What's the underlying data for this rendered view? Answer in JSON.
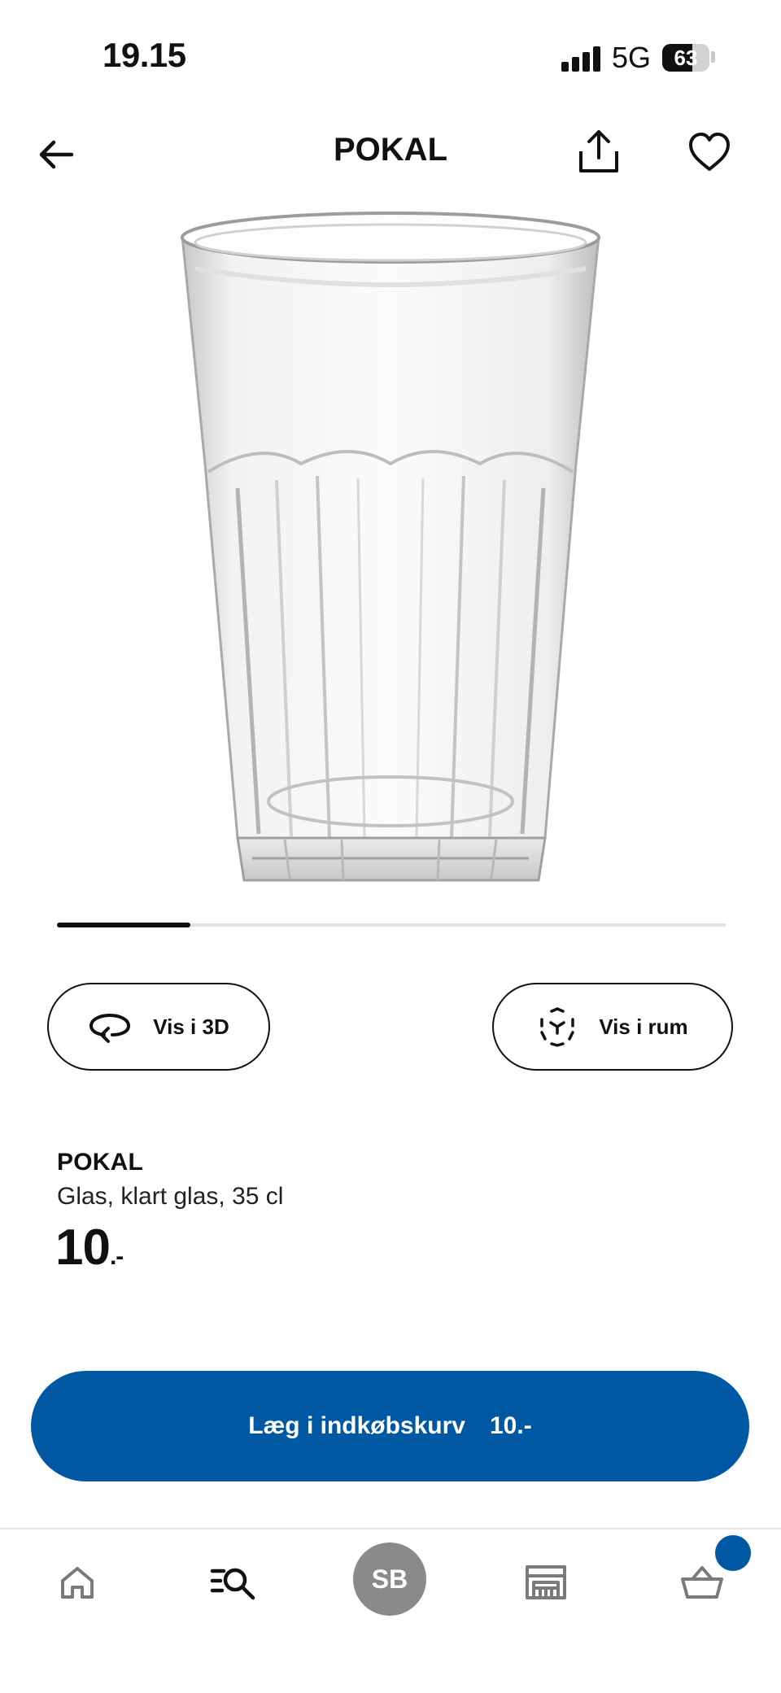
{
  "status_bar": {
    "time": "19.15",
    "network": "5G",
    "battery": "63",
    "battery_level": 0.63
  },
  "header": {
    "title": "POKAL",
    "back_icon": "arrow-left-icon",
    "share_icon": "share-icon",
    "favorite_icon": "heart-icon"
  },
  "carousel": {
    "progress": 0.2
  },
  "actions": {
    "view_3d_label": "Vis i 3D",
    "view_3d_icon": "rotate-3d-icon",
    "view_room_label": "Vis i rum",
    "view_room_icon": "ar-cube-icon"
  },
  "product": {
    "name": "POKAL",
    "description": "Glas, klart glas, 35 cl",
    "price": "10",
    "price_suffix": ".-"
  },
  "cart_cta": {
    "label": "Læg i indkøbskurv",
    "price": "10.-"
  },
  "bottom_nav": {
    "home_icon": "home-icon",
    "search_icon": "search-list-icon",
    "avatar_initials": "SB",
    "stores_icon": "store-icon",
    "cart_icon": "basket-icon"
  },
  "colors": {
    "brand_blue": "#0058a3",
    "text": "#111111",
    "avatar_gray": "#8a8a8a"
  }
}
